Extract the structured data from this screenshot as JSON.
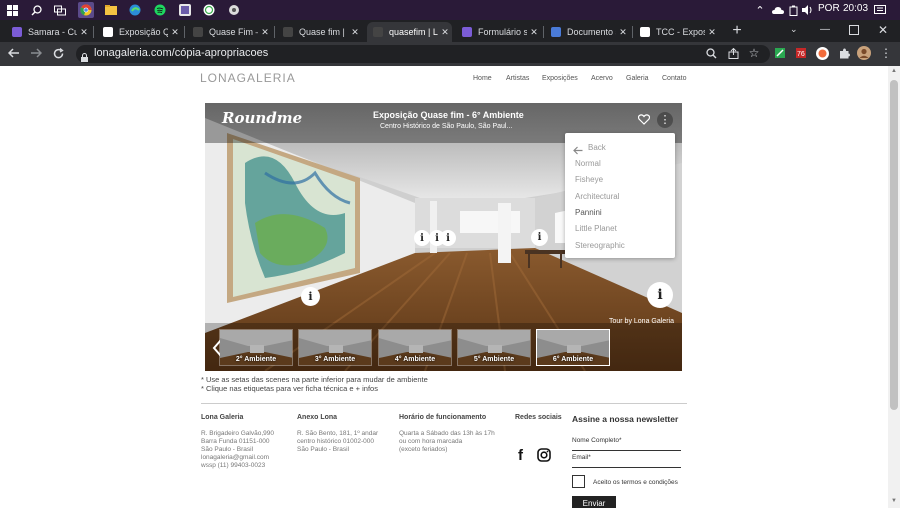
{
  "taskbar": {
    "language": "POR",
    "time": "20:03"
  },
  "tabs": [
    {
      "label": "Samara - Cur",
      "color": "#7b5cd6"
    },
    {
      "label": "Exposição QU",
      "color": "#ffffff"
    },
    {
      "label": "Quase Fim –",
      "color": "#444444"
    },
    {
      "label": "Quase fim | L",
      "color": "#444444"
    },
    {
      "label": "quasefim | Lo",
      "color": "#444444"
    },
    {
      "label": "Formulário se",
      "color": "#7b5cd6"
    },
    {
      "label": "Documento s",
      "color": "#4a7bd8"
    },
    {
      "label": "TCC - Exposiç",
      "color": "#ffffff"
    }
  ],
  "browser": {
    "url": "lonagaleria.com/cópia-apropriacoes"
  },
  "site": {
    "logo": "LONAGALERIA",
    "nav": [
      "Home",
      "Artistas",
      "Exposições",
      "Acervo",
      "Galeria",
      "Contato"
    ]
  },
  "viewer": {
    "brand": "Roundme",
    "title": "Exposição Quase fim - 6° Ambiente",
    "subtitle": "Centro Histórico de São Paulo, São Paul...",
    "credit": "Tour by Lona Galeria",
    "menu": {
      "back": "Back",
      "items": [
        "Normal",
        "Fisheye",
        "Architectural",
        "Pannini",
        "Little Planet",
        "Stereographic"
      ]
    },
    "scenes": [
      "2° Ambiente",
      "3° Ambiente",
      "4° Ambiente",
      "5° Ambiente",
      "6° Ambiente"
    ]
  },
  "notes": [
    "* Use as setas das scenes na parte inferior para mudar de ambiente",
    "* Clique nas etiquetas para ver ficha técnica e + infos"
  ],
  "footer": {
    "col1": {
      "title": "Lona Galeria",
      "lines": [
        "R. Brigadeiro Galvão,990",
        "Barra Funda 01151-000",
        "São Paulo - Brasil",
        "lonagaleria@gmail.com",
        "wssp (11) 99403-0023"
      ]
    },
    "col2": {
      "title": "Anexo Lona",
      "lines": [
        "R. São Bento, 181, 1º andar",
        "centro histórico 01002-000",
        "São Paulo - Brasil"
      ]
    },
    "col3": {
      "title": "Horário de funcionamento",
      "lines": [
        "Quarta a Sábado das 13h às 17h",
        "ou com hora marcada",
        "(exceto feriados)"
      ]
    },
    "col4": {
      "title": "Redes sociais"
    },
    "newsletter": {
      "title": "Assine a nossa newsletter",
      "name_label": "Nome Completo*",
      "email_label": "Email*",
      "terms": "Aceito os termos e condições",
      "submit": "Enviar"
    }
  }
}
